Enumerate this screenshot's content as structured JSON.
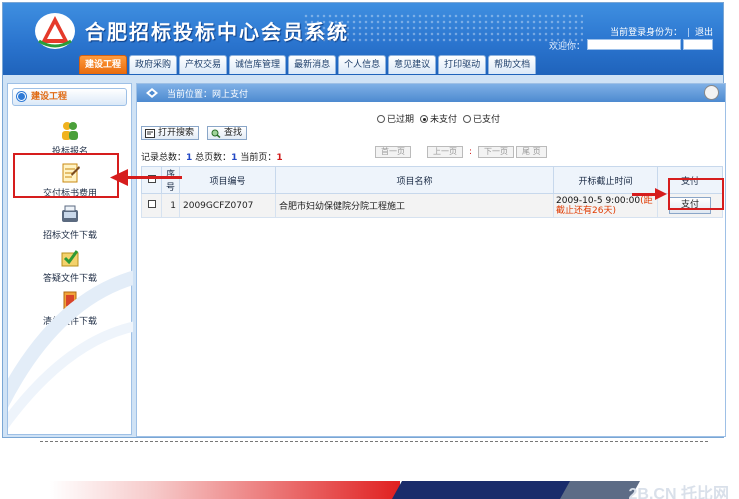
{
  "app": {
    "title": "合肥招标投标中心会员系统",
    "login_label": "当前登录身份为：",
    "separator": "|",
    "logout_label": "退出",
    "welcome_label": "欢迎你："
  },
  "nav": {
    "tabs": [
      "建设工程",
      "政府采购",
      "产权交易",
      "诚信库管理",
      "最新消息",
      "个人信息",
      "意见建议",
      "打印驱动",
      "帮助文档"
    ],
    "active_index": 0
  },
  "sidebar": {
    "header": "建设工程",
    "items": [
      {
        "label": "投标报名",
        "icon": "people-icon"
      },
      {
        "label": "交付标书费用",
        "icon": "pay-document-icon"
      },
      {
        "label": "招标文件下载",
        "icon": "download-icon"
      },
      {
        "label": "答疑文件下载",
        "icon": "answer-download-icon"
      },
      {
        "label": "清单文件下载",
        "icon": "list-download-icon"
      }
    ]
  },
  "breadcrumb": {
    "text": "当前位置：网上支付"
  },
  "filters": {
    "options": [
      "已过期",
      "未支付",
      "已支付"
    ],
    "selected": "未支付"
  },
  "toolbar": {
    "open_search": "打开搜索",
    "search": "查找"
  },
  "stats": {
    "total_label": "记录总数：",
    "total": "1",
    "pages_label": "总页数：",
    "pages": "1",
    "current_label": "当前页：",
    "current": "1"
  },
  "pager": {
    "first": "首一页",
    "prev": "上一页",
    "separator": ":",
    "next": "下一页",
    "last": "尾 页"
  },
  "table": {
    "headers": {
      "seq": "序号",
      "code": "项目编号",
      "name": "项目名称",
      "deadline": "开标截止时间",
      "pay": "支付"
    },
    "rows": [
      {
        "seq": "1",
        "code": "2009GCFZ0707",
        "name": "合肥市妇幼保健院分院工程施工",
        "deadline": "2009-10-5 9:00:00",
        "deadline_suffix": "(距",
        "remain": "截止还有26天)",
        "pay_label": "支付"
      }
    ]
  },
  "footer": {
    "watermark": "2B.CN 托比网"
  },
  "colors": {
    "header_blue": "#2b75cf",
    "active_tab": "#e86b0d",
    "highlight_red": "#d61d1d"
  }
}
